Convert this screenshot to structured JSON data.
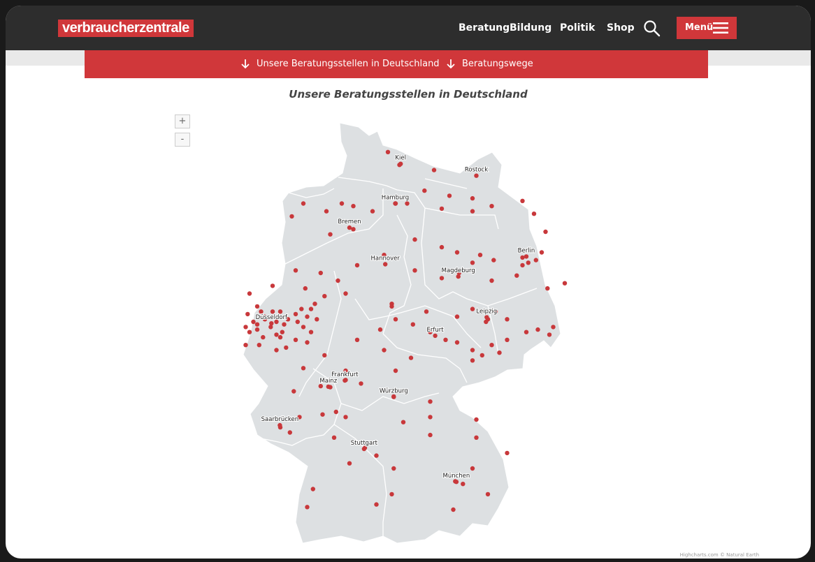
{
  "header": {
    "logo": "verbraucherzentrale",
    "nav": [
      "Beratung",
      "Bildung",
      "Politik",
      "Shop"
    ],
    "menu_label": "Menü",
    "search_icon": "search-icon",
    "menu_icon": "hamburger-icon"
  },
  "subnav": {
    "links": [
      "Unsere Beratungsstellen in Deutschland",
      "Beratungswege"
    ],
    "icon": "arrow-down-icon"
  },
  "map": {
    "title": "Unsere Beratungsstellen in Deutschland",
    "zoom_in": "+",
    "zoom_out": "-",
    "credits": "Highcharts.com © Natural Earth",
    "colors": {
      "land": "#dde0e2",
      "border": "#ffffff",
      "marker": "#c8383b",
      "accent": "#d0373a"
    },
    "cities": [
      {
        "name": "Kiel",
        "lat": 54.32,
        "lon": 10.13
      },
      {
        "name": "Rostock",
        "lat": 54.09,
        "lon": 12.1
      },
      {
        "name": "Hamburg",
        "lat": 53.55,
        "lon": 9.99
      },
      {
        "name": "Bremen",
        "lat": 53.08,
        "lon": 8.8
      },
      {
        "name": "Berlin",
        "lat": 52.52,
        "lon": 13.4
      },
      {
        "name": "Hannover",
        "lat": 52.37,
        "lon": 9.73
      },
      {
        "name": "Magdeburg",
        "lat": 52.13,
        "lon": 11.63
      },
      {
        "name": "Düsseldorf",
        "lat": 51.22,
        "lon": 6.77
      },
      {
        "name": "Leipzig",
        "lat": 51.34,
        "lon": 12.37
      },
      {
        "name": "Erfurt",
        "lat": 50.98,
        "lon": 11.03
      },
      {
        "name": "Frankfurt",
        "lat": 50.11,
        "lon": 8.68
      },
      {
        "name": "Mainz",
        "lat": 49.99,
        "lon": 8.25
      },
      {
        "name": "Würzburg",
        "lat": 49.79,
        "lon": 9.95
      },
      {
        "name": "Saarbrücken",
        "lat": 49.24,
        "lon": 6.99
      },
      {
        "name": "Stuttgart",
        "lat": 48.78,
        "lon": 9.18
      },
      {
        "name": "München",
        "lat": 48.14,
        "lon": 11.58
      }
    ],
    "offices": [
      [
        54.55,
        9.8
      ],
      [
        54.3,
        10.1
      ],
      [
        54.2,
        11.0
      ],
      [
        53.8,
        10.75
      ],
      [
        53.7,
        11.4
      ],
      [
        53.65,
        12.0
      ],
      [
        53.5,
        12.5
      ],
      [
        53.6,
        13.3
      ],
      [
        53.35,
        13.6
      ],
      [
        53.0,
        13.9
      ],
      [
        53.4,
        9.4
      ],
      [
        53.5,
        8.9
      ],
      [
        53.55,
        7.6
      ],
      [
        53.3,
        7.3
      ],
      [
        53.4,
        8.2
      ],
      [
        53.55,
        8.6
      ],
      [
        53.55,
        10.0
      ],
      [
        53.55,
        10.3
      ],
      [
        53.45,
        11.2
      ],
      [
        53.4,
        12.0
      ],
      [
        53.05,
        8.9
      ],
      [
        52.95,
        8.3
      ],
      [
        52.85,
        10.5
      ],
      [
        52.7,
        11.2
      ],
      [
        52.6,
        11.6
      ],
      [
        52.55,
        12.2
      ],
      [
        52.45,
        12.55
      ],
      [
        52.5,
        13.3
      ],
      [
        52.4,
        13.45
      ],
      [
        52.45,
        13.65
      ],
      [
        52.35,
        13.3
      ],
      [
        52.15,
        13.15
      ],
      [
        52.05,
        12.5
      ],
      [
        51.9,
        13.95
      ],
      [
        52.0,
        14.4
      ],
      [
        52.6,
        13.8
      ],
      [
        52.4,
        12.0
      ],
      [
        52.2,
        11.65
      ],
      [
        52.1,
        11.2
      ],
      [
        52.25,
        10.5
      ],
      [
        52.55,
        9.7
      ],
      [
        52.35,
        9.0
      ],
      [
        52.2,
        8.05
      ],
      [
        52.25,
        7.4
      ],
      [
        52.05,
        8.5
      ],
      [
        51.8,
        8.7
      ],
      [
        51.6,
        9.9
      ],
      [
        51.45,
        10.8
      ],
      [
        51.35,
        11.6
      ],
      [
        51.5,
        12.0
      ],
      [
        51.45,
        12.6
      ],
      [
        51.3,
        12.4
      ],
      [
        51.25,
        12.35
      ],
      [
        51.3,
        12.9
      ],
      [
        51.1,
        13.7
      ],
      [
        51.15,
        14.1
      ],
      [
        51.0,
        14.0
      ],
      [
        51.05,
        13.4
      ],
      [
        50.9,
        12.9
      ],
      [
        50.8,
        12.5
      ],
      [
        50.65,
        12.7
      ],
      [
        50.6,
        12.25
      ],
      [
        50.5,
        12.0
      ],
      [
        50.7,
        12.0
      ],
      [
        50.85,
        11.6
      ],
      [
        50.9,
        11.3
      ],
      [
        51.05,
        10.9
      ],
      [
        51.2,
        10.45
      ],
      [
        51.3,
        10.0
      ],
      [
        51.55,
        9.9
      ],
      [
        50.55,
        10.4
      ],
      [
        50.3,
        10.0
      ],
      [
        50.7,
        9.7
      ],
      [
        51.1,
        9.6
      ],
      [
        50.9,
        9.0
      ],
      [
        50.3,
        8.7
      ],
      [
        50.12,
        8.7
      ],
      [
        49.98,
        8.3
      ],
      [
        50.0,
        8.05
      ],
      [
        50.05,
        9.1
      ],
      [
        49.8,
        9.95
      ],
      [
        49.7,
        10.9
      ],
      [
        49.4,
        10.9
      ],
      [
        49.3,
        10.2
      ],
      [
        49.05,
        10.9
      ],
      [
        49.35,
        12.1
      ],
      [
        49.0,
        12.1
      ],
      [
        48.7,
        12.9
      ],
      [
        48.4,
        12.0
      ],
      [
        48.15,
        11.55
      ],
      [
        48.1,
        11.75
      ],
      [
        47.9,
        12.4
      ],
      [
        47.6,
        11.5
      ],
      [
        47.9,
        9.9
      ],
      [
        47.7,
        9.5
      ],
      [
        48.0,
        7.85
      ],
      [
        47.65,
        7.7
      ],
      [
        48.5,
        8.8
      ],
      [
        48.8,
        9.2
      ],
      [
        48.65,
        9.5
      ],
      [
        48.4,
        9.95
      ],
      [
        49.0,
        8.4
      ],
      [
        49.4,
        8.7
      ],
      [
        49.5,
        8.45
      ],
      [
        49.45,
        8.1
      ],
      [
        49.9,
        7.35
      ],
      [
        49.2,
        7.0
      ],
      [
        49.1,
        7.25
      ],
      [
        49.4,
        7.5
      ],
      [
        50.35,
        7.6
      ],
      [
        50.75,
        7.15
      ],
      [
        50.95,
        7.0
      ],
      [
        50.6,
        8.15
      ],
      [
        51.2,
        6.4
      ],
      [
        51.05,
        6.2
      ],
      [
        50.95,
        6.55
      ],
      [
        50.8,
        6.1
      ],
      [
        51.15,
        6.1
      ],
      [
        51.25,
        6.3
      ],
      [
        51.35,
        6.6
      ],
      [
        51.45,
        6.8
      ],
      [
        51.25,
        6.9
      ],
      [
        51.2,
        7.1
      ],
      [
        51.3,
        7.2
      ],
      [
        51.4,
        7.4
      ],
      [
        51.45,
        7.0
      ],
      [
        51.5,
        7.55
      ],
      [
        51.5,
        7.8
      ],
      [
        51.35,
        7.7
      ],
      [
        51.3,
        7.95
      ],
      [
        51.6,
        7.9
      ],
      [
        51.75,
        8.15
      ],
      [
        51.9,
        7.65
      ],
      [
        51.95,
        6.8
      ],
      [
        51.8,
        6.2
      ],
      [
        51.55,
        6.4
      ],
      [
        51.45,
        6.5
      ],
      [
        51.0,
        6.9
      ],
      [
        50.9,
        7.4
      ],
      [
        50.85,
        7.7
      ],
      [
        51.05,
        7.8
      ],
      [
        51.15,
        7.6
      ],
      [
        51.4,
        6.15
      ],
      [
        51.3,
        6.6
      ],
      [
        51.1,
        6.4
      ],
      [
        51.15,
        6.75
      ],
      [
        51.05,
        7.05
      ],
      [
        50.8,
        6.45
      ],
      [
        50.7,
        6.9
      ],
      [
        51.25,
        7.45
      ]
    ]
  }
}
